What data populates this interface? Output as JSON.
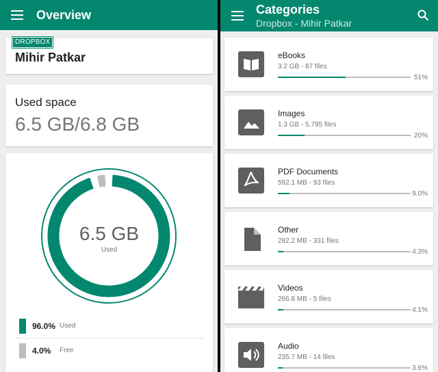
{
  "colors": {
    "accent": "#04876f",
    "free": "#bdbdbd"
  },
  "overview": {
    "title": "Overview",
    "menu_icon": "menu-icon",
    "account": {
      "badge": "DROPBOX",
      "name": "Mihir Patkar"
    },
    "used_space": {
      "label": "Used space",
      "value": "6.5 GB/6.8 GB"
    },
    "donut": {
      "value": "6.5 GB",
      "caption": "Used",
      "used_fraction": 0.96
    },
    "legend": [
      {
        "percent": "96.0%",
        "label": "Used",
        "color": "#04876f"
      },
      {
        "percent": "4.0%",
        "label": "Free",
        "color": "#bdbdbd"
      }
    ]
  },
  "categories": {
    "title": "Categories",
    "subtitle": "Dropbox - Mihir Patkar",
    "menu_icon": "menu-icon",
    "search_icon": "search-icon",
    "items": [
      {
        "name": "eBooks",
        "meta": "3.2 GB - 87 files",
        "percent": "51%",
        "fraction": 0.51,
        "icon": "book-icon"
      },
      {
        "name": "Images",
        "meta": "1.3 GB - 5,795 files",
        "percent": "20%",
        "fraction": 0.2,
        "icon": "image-icon"
      },
      {
        "name": "PDF Documents",
        "meta": "592.1 MB - 93 files",
        "percent": "9.0%",
        "fraction": 0.09,
        "icon": "pdf-icon"
      },
      {
        "name": "Other",
        "meta": "282.2 MB - 331 files",
        "percent": "4.3%",
        "fraction": 0.043,
        "icon": "file-icon"
      },
      {
        "name": "Videos",
        "meta": "266.8 MB - 5 files",
        "percent": "4.1%",
        "fraction": 0.041,
        "icon": "video-icon"
      },
      {
        "name": "Audio",
        "meta": "235.7 MB - 14 files",
        "percent": "3.6%",
        "fraction": 0.036,
        "icon": "audio-icon"
      }
    ]
  }
}
